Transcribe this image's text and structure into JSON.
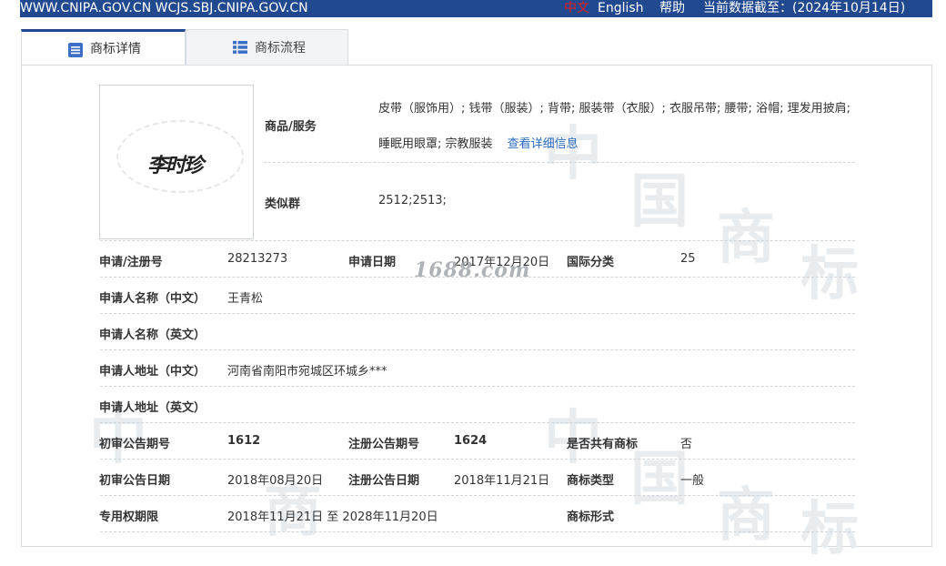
{
  "topbar": {
    "site": "WWW.CNIPA.GOV.CN WCJS.SBJ.CNIPA.GOV.CN",
    "lang_cn": "中文",
    "lang_en": "English",
    "help": "帮助",
    "data_date": "当前数据截至：(2024年10月14日)"
  },
  "tabs": [
    {
      "label": "商标详情",
      "icon": "document-list-icon",
      "active": true
    },
    {
      "label": "商标流程",
      "icon": "list-icon",
      "active": false
    }
  ],
  "trademark": {
    "image_text": "李时珍",
    "goods_label": "商品/服务",
    "goods_text": "皮带（服饰用）; 钱带（服装）; 背带; 服装带（衣服）; 衣服吊带; 腰带; 浴帽; 理发用披肩; 睡眠用眼罩; 宗教服装",
    "goods_link": "查看详细信息",
    "similar_label": "类似群",
    "similar_value": "2512;2513;"
  },
  "fields": {
    "reg_no_label": "申请/注册号",
    "reg_no": "28213273",
    "apply_date_label": "申请日期",
    "apply_date": "2017年12月20日",
    "intl_class_label": "国际分类",
    "intl_class": "25",
    "applicant_cn_label": "申请人名称（中文）",
    "applicant_cn": "王青松",
    "applicant_en_label": "申请人名称（英文）",
    "applicant_en": "",
    "address_cn_label": "申请人地址（中文）",
    "address_cn": "河南省南阳市宛城区环城乡***",
    "address_en_label": "申请人地址（英文）",
    "address_en": "",
    "prelim_no_label": "初审公告期号",
    "prelim_no": "1612",
    "reg_pub_no_label": "注册公告期号",
    "reg_pub_no": "1624",
    "shared_label": "是否共有商标",
    "shared": "否",
    "prelim_date_label": "初审公告日期",
    "prelim_date": "2018年08月20日",
    "reg_pub_date_label": "注册公告日期",
    "reg_pub_date": "2018年11月21日",
    "tm_type_label": "商标类型",
    "tm_type": "一般",
    "term_label": "专用权期限",
    "term": "2018年11月21日 至 2028年11月20日",
    "tm_form_label": "商标形式",
    "tm_form": ""
  },
  "watermark": {
    "site": "1688.com",
    "chars": [
      "中",
      "国",
      "商",
      "标"
    ]
  },
  "colors": {
    "topbar": "#21498f",
    "accent": "#2a6bbf",
    "lang_active": "#e11e1e"
  }
}
